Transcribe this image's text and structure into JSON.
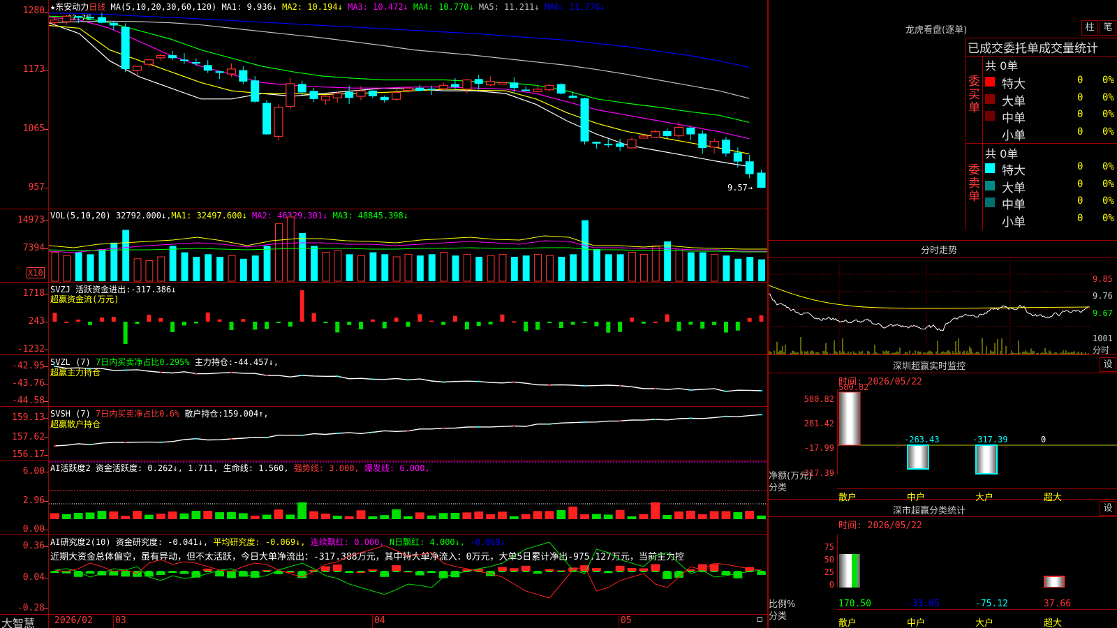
{
  "app": {
    "brand": "大智慧",
    "stock_name": "东安动力",
    "period": "日线"
  },
  "price_chart": {
    "ma_label": "MA(5,10,20,30,60,120)",
    "ma": [
      {
        "name": "MA1",
        "value": "9.936↓",
        "color": "#ffffff"
      },
      {
        "name": "MA2",
        "value": "10.194↓",
        "color": "#ffff00"
      },
      {
        "name": "MA3",
        "value": "10.472↓",
        "color": "#ff00ff"
      },
      {
        "name": "MA4",
        "value": "10.770↓",
        "color": "#00ff00"
      },
      {
        "name": "MA5",
        "value": "11.211↓",
        "color": "#c0c0c0"
      },
      {
        "name": "MA6",
        "value": "11.776↓",
        "color": "#0000ff"
      }
    ],
    "y_ticks": [
      "1280",
      "1173",
      "1065",
      "957"
    ],
    "high_label": "12.75",
    "last_label": "9.57"
  },
  "vol": {
    "label": "VOL(5,10,20)",
    "value": "32792.000↓",
    "ma": [
      {
        "name": "MA1",
        "value": "32497.600↓",
        "color": "#ffff00"
      },
      {
        "name": "MA2",
        "value": "46329.301↓",
        "color": "#ff00ff"
      },
      {
        "name": "MA3",
        "value": "48845.398↓",
        "color": "#00ff00"
      }
    ],
    "y_ticks": [
      "14973",
      "7394"
    ],
    "unit": "X10"
  },
  "svzj": {
    "label": "SVZJ",
    "title": "活跃资金进出:",
    "value": "-317.386↓",
    "sub": "超赢资金流(万元)",
    "y_ticks": [
      "1718",
      "243",
      "-1232"
    ]
  },
  "svzl": {
    "label": "SVZL (7)",
    "ratio_text": "7日内买卖净占比0.295%",
    "hold_label": "主力持仓:",
    "hold_value": "-44.457↓,",
    "sub": "超赢主力持仓",
    "y_ticks": [
      "-42.95",
      "-43.76",
      "-44.58"
    ]
  },
  "svsh": {
    "label": "SVSH (7)",
    "ratio_text": "7日内买卖净占比0.6%",
    "hold_label": "散户持仓:",
    "hold_value": "159.004↑,",
    "sub": "超赢散户持仓",
    "y_ticks": [
      "159.13",
      "157.62",
      "156.17"
    ]
  },
  "ai_active": {
    "label": "AI活跃度2",
    "a_label": "资金活跃度:",
    "a_value": "0.262↓,",
    "b_value": "1.711,",
    "c_label": "生命线:",
    "c_value": "1.560,",
    "d_text": "强势线: 3.000,",
    "e_text": "爆发线: 6.000,",
    "y_ticks": [
      "6.00",
      "2.96",
      "0.00"
    ]
  },
  "ai_research": {
    "label": "AI研究度2(10)",
    "a_label": "资金研究度:",
    "a_value": "-0.041↓,",
    "b_text": "平均研究度: -0.069↓,",
    "c_text": "连续飘红: 0.000,",
    "d_text": "N日飘红: 4.000↓,",
    "e_text": "-0.069↓",
    "comment": "近期大资金总体偏空，虽有异动，但不太活跃，今日大单净流出：-317.388万元，其中特大单净流入：0万元，大单5日累计净出-975.127万元，当前主力控",
    "y_ticks": [
      "0.36",
      "0.04",
      "-0.28"
    ]
  },
  "x_axis": {
    "labels": [
      "2026/02",
      "03",
      "04",
      "05"
    ]
  },
  "longhu": {
    "title": "龙虎看盘(逐单)",
    "btn_a": "柱",
    "btn_b": "笔",
    "subtitle": "已成交委托单成交量统计",
    "buy": {
      "side": "委买单",
      "total": "共 0单",
      "rows": [
        {
          "label": "特大",
          "color": "#ff0000",
          "v": "0",
          "p": "0%"
        },
        {
          "label": "大单",
          "color": "#8b0000",
          "v": "0",
          "p": "0%"
        },
        {
          "label": "中单",
          "color": "#700000",
          "v": "0",
          "p": "0%"
        },
        {
          "label": "小单",
          "color": "#000000",
          "v": "0",
          "p": "0%"
        }
      ]
    },
    "sell": {
      "side": "委卖单",
      "total": "共 0单",
      "rows": [
        {
          "label": "特大",
          "color": "#00ffff",
          "v": "0",
          "p": "0%"
        },
        {
          "label": "大单",
          "color": "#008b8b",
          "v": "0",
          "p": "0%"
        },
        {
          "label": "中单",
          "color": "#007070",
          "v": "0",
          "p": "0%"
        },
        {
          "label": "小单",
          "color": "#000000",
          "v": "0",
          "p": "0%"
        }
      ]
    }
  },
  "intraday": {
    "title": "分时走势",
    "y_ticks": [
      "9.85",
      "9.76",
      "9.67"
    ],
    "vol_tick": "1001",
    "unit": "分时"
  },
  "monitor": {
    "title": "深圳超赢实时监控",
    "btn": "设",
    "time": "时间: 2026/05/22",
    "y_ticks": [
      "580.82",
      "281.42",
      "-17.99",
      "-317.39"
    ],
    "top_value": "580.82",
    "labels": {
      "net": "净额(万元)",
      "cat": "分类"
    },
    "categories": [
      "散户",
      "中户",
      "大户",
      "超大"
    ],
    "values": [
      "580.82",
      "-263.43",
      "-317.39",
      "0"
    ]
  },
  "stats": {
    "title": "深市超赢分类统计",
    "btn": "设",
    "time": "时间: 2026/05/22",
    "y_ticks": [
      "75",
      "50",
      "25",
      "0"
    ],
    "labels": {
      "ratio": "比例%",
      "cat": "分类"
    },
    "categories": [
      "散户",
      "中户",
      "大户",
      "超大"
    ],
    "values": [
      "170.50",
      "-33.05",
      "-75.12",
      "37.66"
    ]
  }
}
